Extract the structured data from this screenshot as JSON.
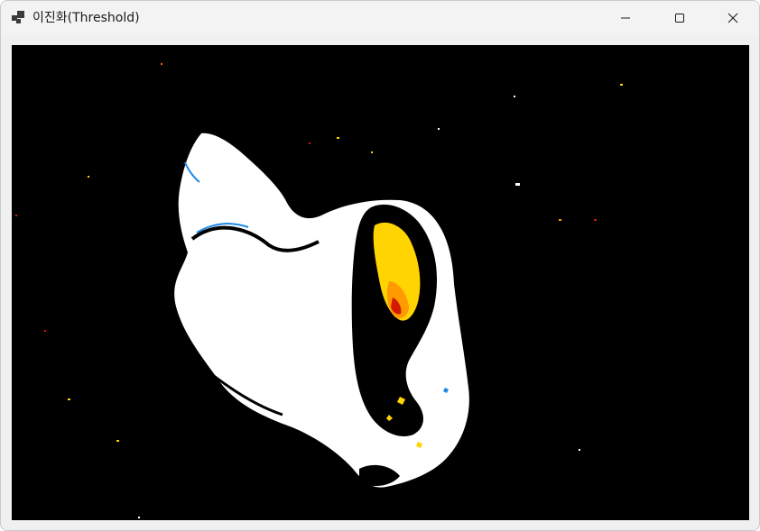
{
  "window": {
    "title": "이진화(Threshold)",
    "app_icon": "windows-forms-app-icon"
  },
  "controls": {
    "minimize_icon": "minimize-icon",
    "maximize_icon": "maximize-icon",
    "close_icon": "close-icon"
  },
  "image": {
    "subject_icon": "thresholded-swan-image",
    "background_color": "#000000",
    "foreground_color": "#ffffff",
    "accent_colors": [
      "#ffd400",
      "#d21a00",
      "#1e88e5"
    ]
  }
}
